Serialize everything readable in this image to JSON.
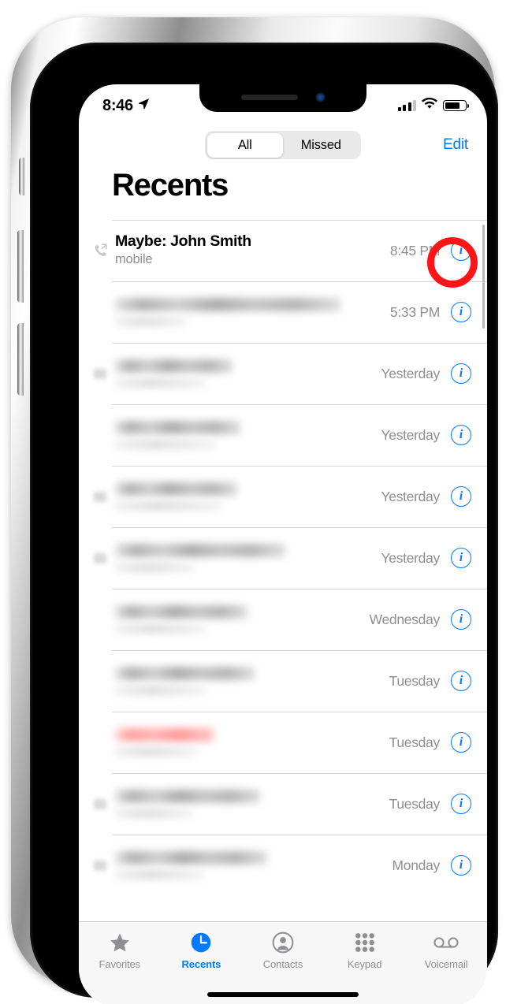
{
  "status_bar": {
    "time": "8:46",
    "location_icon": "location-arrow-icon",
    "signal_icon": "cellular-signal-icon",
    "wifi_icon": "wifi-icon",
    "battery_icon": "battery-icon"
  },
  "nav": {
    "segments": [
      {
        "label": "All",
        "selected": true
      },
      {
        "label": "Missed",
        "selected": false
      }
    ],
    "edit_label": "Edit"
  },
  "page_title": "Recents",
  "calls": [
    {
      "name": "Maybe: John Smith",
      "subtitle": "mobile",
      "time": "8:45 PM",
      "call_type_icon": "outgoing-call-icon",
      "redacted": false,
      "annotated": true
    },
    {
      "name": "",
      "subtitle": "",
      "time": "5:33 PM",
      "call_type_icon": "",
      "redacted": true,
      "redact_style": "gray"
    },
    {
      "name": "",
      "subtitle": "",
      "time": "Yesterday",
      "call_type_icon": "call-type-icon",
      "redacted": true,
      "redact_style": "gray"
    },
    {
      "name": "",
      "subtitle": "",
      "time": "Yesterday",
      "call_type_icon": "",
      "redacted": true,
      "redact_style": "gray"
    },
    {
      "name": "",
      "subtitle": "",
      "time": "Yesterday",
      "call_type_icon": "call-type-icon",
      "redacted": true,
      "redact_style": "gray"
    },
    {
      "name": "",
      "subtitle": "",
      "time": "Yesterday",
      "call_type_icon": "call-type-icon",
      "redacted": true,
      "redact_style": "gray"
    },
    {
      "name": "",
      "subtitle": "",
      "time": "Wednesday",
      "call_type_icon": "",
      "redacted": true,
      "redact_style": "gray"
    },
    {
      "name": "",
      "subtitle": "",
      "time": "Tuesday",
      "call_type_icon": "",
      "redacted": true,
      "redact_style": "gray"
    },
    {
      "name": "",
      "subtitle": "",
      "time": "Tuesday",
      "call_type_icon": "",
      "redacted": true,
      "redact_style": "red"
    },
    {
      "name": "",
      "subtitle": "",
      "time": "Tuesday",
      "call_type_icon": "call-type-icon",
      "redacted": true,
      "redact_style": "gray"
    },
    {
      "name": "",
      "subtitle": "",
      "time": "Monday",
      "call_type_icon": "call-type-icon",
      "redacted": true,
      "redact_style": "gray"
    }
  ],
  "info_button_glyph": "i",
  "tabs": [
    {
      "label": "Favorites",
      "icon": "star-icon",
      "active": false
    },
    {
      "label": "Recents",
      "icon": "clock-icon",
      "active": true
    },
    {
      "label": "Contacts",
      "icon": "person-circle-icon",
      "active": false
    },
    {
      "label": "Keypad",
      "icon": "keypad-dots-icon",
      "active": false
    },
    {
      "label": "Voicemail",
      "icon": "voicemail-icon",
      "active": false
    }
  ],
  "annotation": {
    "shape": "circle-highlight",
    "color": "#ff1418",
    "target": "info-button-row-1"
  },
  "colors": {
    "accent": "#007aff",
    "secondary_text": "#8e8e93",
    "annotation_red": "#ff1418",
    "tabbar_bg": "#f7f7f8"
  }
}
